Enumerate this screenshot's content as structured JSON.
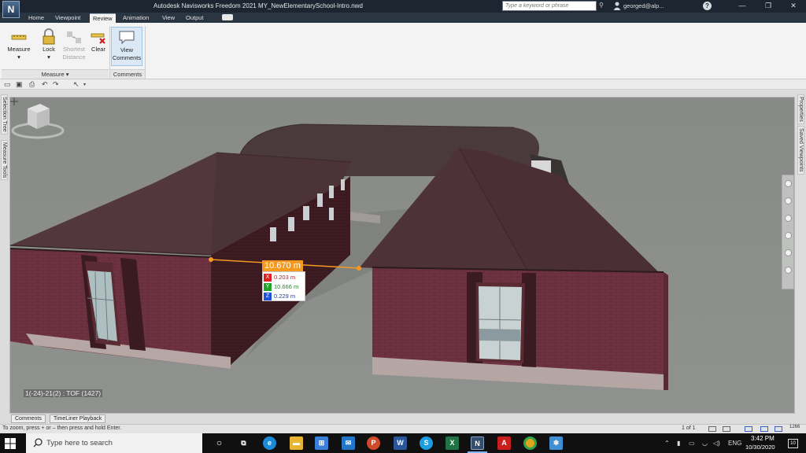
{
  "window": {
    "title": "Autodesk Navisworks Freedom 2021    MY_NewElementarySchool-Intro.nwd",
    "logo_letter": "N",
    "search_placeholder": "Type a keyword or phrase",
    "user": "georged@alp...",
    "help": "?",
    "minimize": "—",
    "maximize": "❐",
    "close": "✕"
  },
  "ribbon_tabs": [
    "Home",
    "Viewpoint",
    "Review",
    "Animation",
    "View",
    "Output"
  ],
  "active_tab": "Review",
  "ribbon": {
    "buttons": {
      "measure": "Measure",
      "lock": "Lock",
      "shortest_1": "Shortest",
      "shortest_2": "Distance",
      "clear": "Clear",
      "view_1": "View",
      "view_2": "Comments"
    },
    "panels": {
      "measure": "Measure",
      "comments": "Comments"
    }
  },
  "side_tabs": {
    "left": [
      "Selection Tree",
      "Measure Tools"
    ],
    "right": [
      "Properties",
      "Saved Viewpoints"
    ]
  },
  "measurement": {
    "total": "10.670 m",
    "rows": [
      {
        "axis": "X",
        "value": "0.203 m",
        "color": "#e02020"
      },
      {
        "axis": "Y",
        "value": "10.666 m",
        "color": "#1fa32a"
      },
      {
        "axis": "Z",
        "value": "0.229 m",
        "color": "#2050d8"
      }
    ]
  },
  "viewpoint_label": "1(-24)-21(2) : TOF (1427)",
  "bottom_tabs": [
    "Comments",
    "TimeLiner Playback"
  ],
  "status": {
    "hint": "To zoom, press + or – then press and hold Enter.",
    "page": "1 of 1",
    "memory": "1266"
  },
  "taskbar": {
    "search_placeholder": "Type here to search",
    "language": "ENG",
    "time": "3:42 PM",
    "date": "10/30/2020",
    "notifications": "10",
    "apps": [
      "task-view",
      "edge",
      "file-explorer",
      "store",
      "mail",
      "powerpoint",
      "word",
      "skype",
      "excel",
      "navisworks",
      "acrobat",
      "chrome",
      "app"
    ]
  }
}
